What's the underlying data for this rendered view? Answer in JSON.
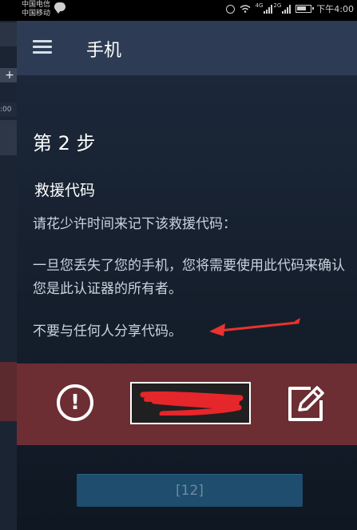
{
  "status_bar": {
    "carrier_1": "中国电信",
    "carrier_2": "中国移动",
    "net_1": "4G",
    "net_2": "2G",
    "time": "下午4:00"
  },
  "background_app": {
    "plus_label": "+",
    "time_fragment": ":00"
  },
  "header": {
    "title": "手机",
    "menu_icon": "hamburger-icon"
  },
  "content": {
    "step_title": "第 2 步",
    "section_title": "救援代码",
    "instruction": "请花少许时间来记下该救援代码：",
    "explanation": "一旦您丢失了您的手机，您将需要使用此代码来确认您是此认证器的所有者。",
    "warning": "不要与任何人分享代码。"
  },
  "code_band": {
    "background_color": "#6c2e33",
    "info_icon": "exclamation-circle-icon",
    "edit_icon": "edit-icon",
    "code_value": ""
  },
  "bottom": {
    "button_label": "[12]"
  },
  "annotation": {
    "arrow_color": "#e8332e"
  }
}
